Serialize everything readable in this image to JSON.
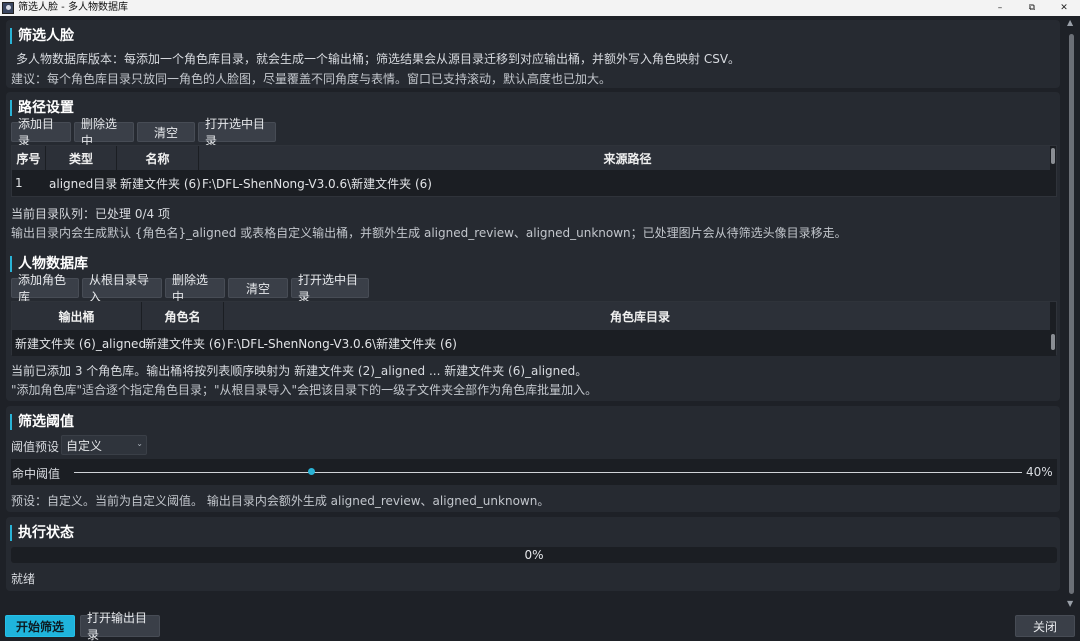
{
  "window": {
    "title": "筛选人脸 - 多人物数据库",
    "minimize": "–",
    "maximize": "⧉",
    "close": "✕"
  },
  "intro": {
    "title": "筛选人脸",
    "line1": "多人物数据库版本：每添加一个角色库目录，就会生成一个输出桶；筛选结果会从源目录迁移到对应输出桶，并额外写入角色映射 CSV。",
    "line2": "建议：每个角色库目录只放同一角色的人脸图，尽量覆盖不同角度与表情。窗口已支持滚动，默认高度也已加大。"
  },
  "paths": {
    "title": "路径设置",
    "buttons": [
      "添加目录",
      "删除选中",
      "清空",
      "打开选中目录"
    ],
    "columns": [
      "序号",
      "类型",
      "名称",
      "来源路径"
    ],
    "rows": [
      [
        "1",
        "aligned目录",
        "新建文件夹 (6)",
        "F:\\DFL-ShenNong-V3.0.6\\新建文件夹 (6)"
      ]
    ],
    "queue_status": "当前目录队列：已处理 0/4 项",
    "note": "输出目录内会生成默认 {角色名}_aligned 或表格自定义输出桶，并额外生成 aligned_review、aligned_unknown；已处理图片会从待筛选头像目录移走。"
  },
  "database": {
    "title": "人物数据库",
    "buttons": [
      "添加角色库",
      "从根目录导入",
      "删除选中",
      "清空",
      "打开选中目录"
    ],
    "columns": [
      "输出桶",
      "角色名",
      "角色库目录"
    ],
    "rows": [
      [
        "新建文件夹 (6)_aligned",
        "新建文件夹 (6)",
        "F:\\DFL-ShenNong-V3.0.6\\新建文件夹 (6)"
      ]
    ],
    "summary": "当前已添加 3 个角色库。输出桶将按列表顺序映射为 新建文件夹 (2)_aligned ... 新建文件夹 (6)_aligned。",
    "hint": "\"添加角色库\"适合逐个指定角色目录；\"从根目录导入\"会把该目录下的一级子文件夹全部作为角色库批量加入。"
  },
  "threshold": {
    "title": "筛选阈值",
    "preset_label": "阈值预设",
    "preset_value": "自定义",
    "hit_label": "命中阈值",
    "hit_value": 0.25,
    "hit_text": "40%",
    "note": "预设：自定义。当前为自定义阈值。 输出目录内会额外生成 aligned_review、aligned_unknown。"
  },
  "status": {
    "title": "执行状态",
    "progress_text": "0%",
    "state": "就绪"
  },
  "footer": {
    "start": "开始筛选",
    "open_output": "打开输出目录",
    "close": "关闭"
  }
}
